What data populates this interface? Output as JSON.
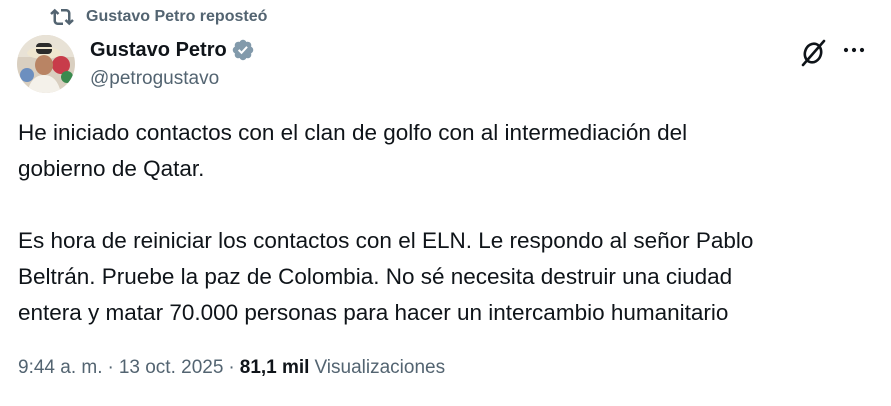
{
  "repost": {
    "icon": "repost-icon",
    "label": "Gustavo Petro reposteó"
  },
  "author": {
    "avatar": "avatar",
    "name": "Gustavo Petro",
    "verified_icon": "verified-badge-icon",
    "handle": "@petrogustavo"
  },
  "actions": {
    "grok_icon": "grok-icon",
    "more_icon": "more-options-icon"
  },
  "tweet": {
    "paragraph1_line1": "He iniciado contactos con el clan de golfo con al intermediación del",
    "paragraph1_line2": "gobierno de Qatar.",
    "paragraph2_line1": "Es hora de reiniciar los contactos con el ELN. Le respondo al señor Pablo",
    "paragraph2_line2": "Beltrán. Pruebe la paz de Colombia. No sé necesita destruir una ciudad",
    "paragraph2_line3": "entera y matar 70.000 personas para hacer un intercambio humanitario"
  },
  "meta": {
    "time": "9:44 a. m.",
    "separator": "·",
    "date": "13 oct. 2025",
    "views_count": "81,1 mil",
    "views_label": "Visualizaciones"
  },
  "colors": {
    "text": "#0f1419",
    "secondary": "#536471",
    "verified": "#829aab",
    "background": "#ffffff"
  }
}
